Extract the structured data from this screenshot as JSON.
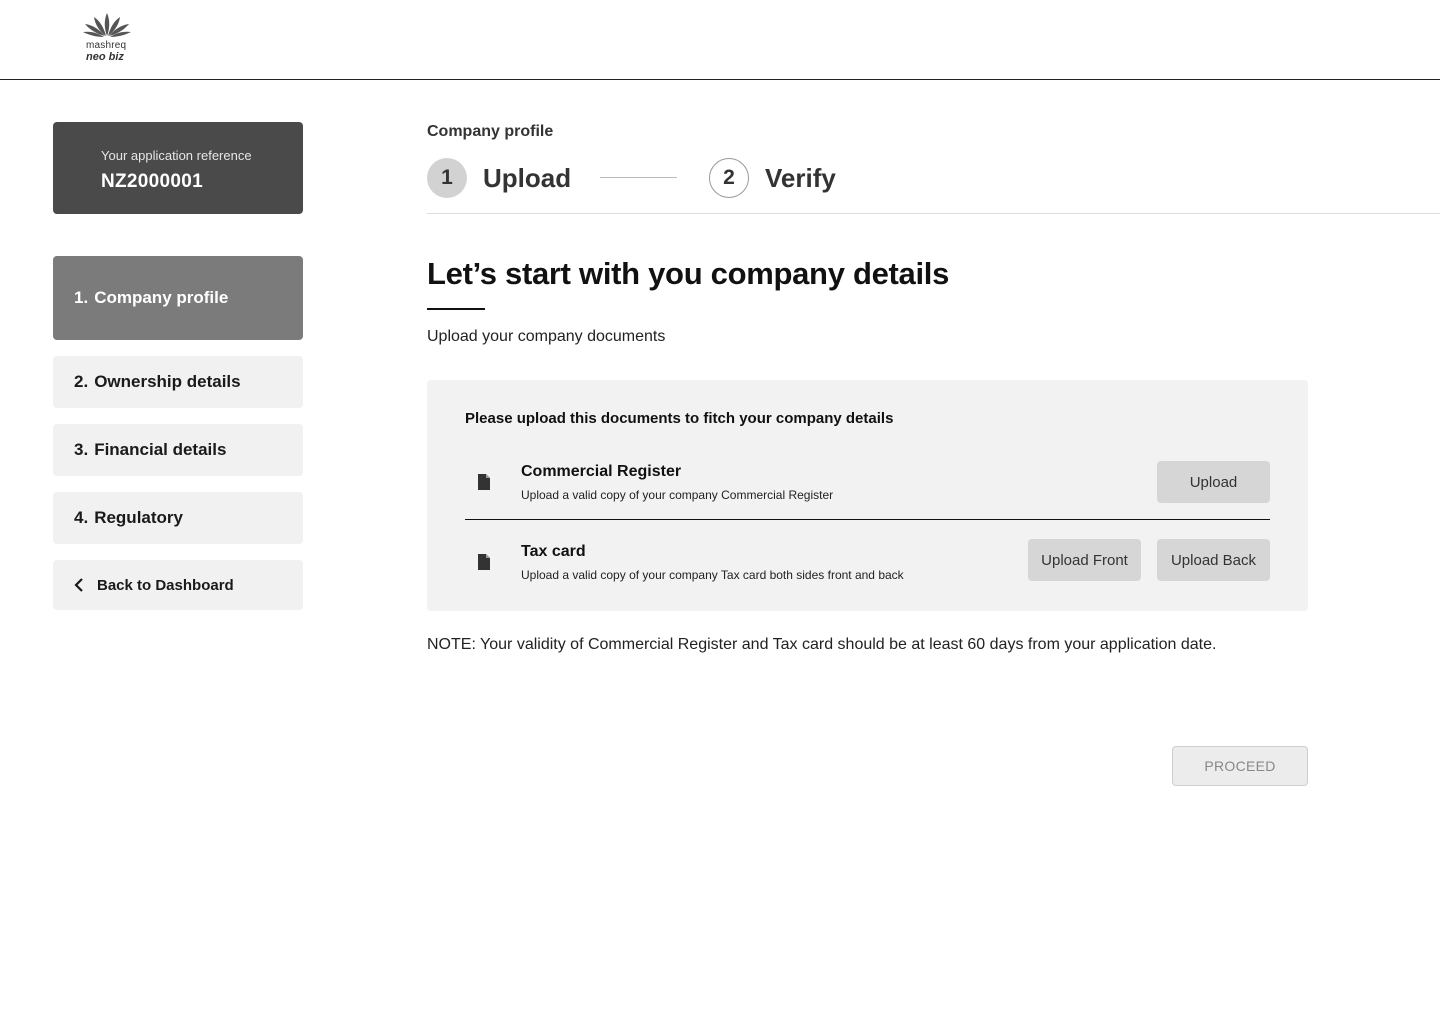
{
  "brand": {
    "name_top": "mashreq",
    "name_bottom": "neo biz"
  },
  "sidebar": {
    "reference_label": "Your application reference",
    "reference_value": "NZ2000001",
    "items": [
      {
        "num": "1.",
        "label": "Company profile",
        "active": true
      },
      {
        "num": "2.",
        "label": "Ownership details",
        "active": false
      },
      {
        "num": "3.",
        "label": "Financial details",
        "active": false
      },
      {
        "num": "4.",
        "label": "Regulatory",
        "active": false
      }
    ],
    "back_label": "Back to Dashboard",
    "back_icon": "chevron-left-icon"
  },
  "stepper": {
    "section_label": "Company profile",
    "steps": [
      {
        "num": "1",
        "label": "Upload",
        "active": true
      },
      {
        "num": "2",
        "label": "Verify",
        "active": false
      }
    ]
  },
  "main": {
    "heading": "Let’s start with you company details",
    "subheading": "Upload your company documents",
    "panel_title": "Please upload this documents to fitch your company details",
    "documents": [
      {
        "icon": "document-icon",
        "title": "Commercial Register",
        "description": "Upload a valid copy of your company Commercial Register",
        "buttons": [
          "Upload"
        ]
      },
      {
        "icon": "document-icon",
        "title": "Tax card",
        "description": "Upload a valid copy of your company Tax card both sides front and back",
        "buttons": [
          "Upload Front",
          "Upload Back"
        ]
      }
    ],
    "note": "NOTE: Your validity of Commercial Register and Tax card should be at least 60 days from your application date.",
    "proceed_label": "PROCEED"
  },
  "colors": {
    "ref_card_bg": "#4a4a4a",
    "active_nav_bg": "#7b7b7b",
    "nav_bg": "#f1f1f1",
    "panel_bg": "#f2f2f2",
    "button_bg": "#d6d6d6"
  }
}
